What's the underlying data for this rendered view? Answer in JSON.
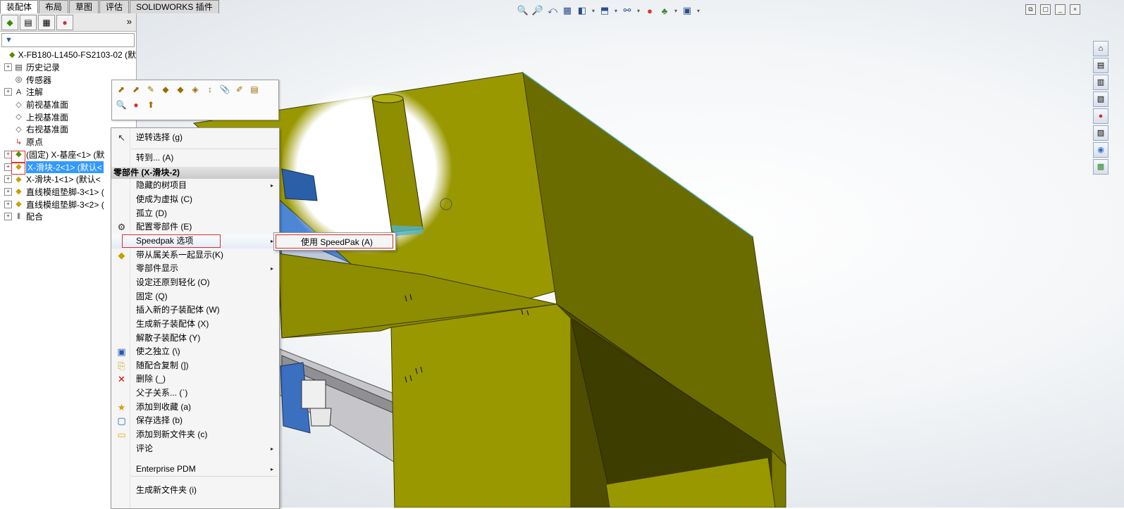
{
  "tabs": [
    "装配体",
    "布局",
    "草图",
    "评估",
    "SOLIDWORKS 插件"
  ],
  "active_tab": 0,
  "view_toolbar_icons": [
    "zoom-to-fit-icon",
    "zoom-to-area-icon",
    "previous-view-icon",
    "section-view-icon",
    "view-orientation-icon",
    "display-style-icon",
    "hide-show-items-icon",
    "edit-appearance-icon",
    "apply-scene-icon",
    "view-settings-icon"
  ],
  "window_controls": [
    "restore",
    "tile",
    "minimize-window",
    "close"
  ],
  "task_pane_icons": [
    "home-icon",
    "resources-icon",
    "design-library-icon",
    "file-explorer-icon",
    "view-palette-icon",
    "appearances-icon",
    "custom-properties-icon",
    "forum-icon"
  ],
  "feature_manager": {
    "more_label": "»",
    "filter_label": "▼",
    "tree": [
      {
        "label": "X-FB180-L1450-FS2103-02  (默",
        "icon": "assembly-icon",
        "expand": "",
        "indent": 0
      },
      {
        "label": "历史记录",
        "icon": "history-icon",
        "expand": "+",
        "indent": 1
      },
      {
        "label": "传感器",
        "icon": "sensor-icon",
        "expand": "",
        "indent": 1
      },
      {
        "label": "注解",
        "icon": "annotation-icon",
        "expand": "+",
        "indent": 1
      },
      {
        "label": "前视基准面",
        "icon": "plane-icon",
        "expand": "",
        "indent": 1
      },
      {
        "label": "上视基准面",
        "icon": "plane-icon",
        "expand": "",
        "indent": 1
      },
      {
        "label": "右视基准面",
        "icon": "plane-icon",
        "expand": "",
        "indent": 1
      },
      {
        "label": "原点",
        "icon": "origin-icon",
        "expand": "",
        "indent": 1
      },
      {
        "label": "(固定) X-基座<1> (默",
        "icon": "fixed-part-icon",
        "expand": "+",
        "indent": 1
      },
      {
        "label": "X-滑块-2<1> (默认<",
        "icon": "subassembly-icon",
        "expand": "+",
        "indent": 1,
        "selected": true
      },
      {
        "label": "X-滑块-1<1> (默认<",
        "icon": "subassembly-icon",
        "expand": "+",
        "indent": 1
      },
      {
        "label": "直线模组垫脚-3<1> (",
        "icon": "subassembly-icon",
        "expand": "+",
        "indent": 1
      },
      {
        "label": "直线模组垫脚-3<2> (",
        "icon": "subassembly-icon",
        "expand": "+",
        "indent": 1
      },
      {
        "label": "配合",
        "icon": "mates-icon",
        "expand": "+",
        "indent": 1
      }
    ]
  },
  "context_toolbar": {
    "row1": [
      "open-part-icon",
      "open-assembly-icon",
      "edit-part-icon",
      "edit-assembly-icon",
      "component-properties-icon",
      "hide-components-icon",
      "move-components-icon",
      "mate-icon",
      "edit-sketch-icon",
      "properties-icon"
    ],
    "row2": [
      "zoom-to-selection-icon",
      "appearance-icon",
      "make-virtual-icon"
    ]
  },
  "context_menu": {
    "header": "零部件 (X-滑块-2)",
    "items": [
      {
        "label": "逆转选择 (g)",
        "icon": "select-cursor-icon"
      },
      {
        "label": "转到... (A)",
        "icon": ""
      },
      {
        "label": "隐藏的树项目",
        "icon": "",
        "submenu": true
      },
      {
        "label": "使成为虚拟 (C)",
        "icon": ""
      },
      {
        "label": "孤立 (D)",
        "icon": ""
      },
      {
        "label": "配置零部件 (E)",
        "icon": "configure-component-icon"
      },
      {
        "label": "Speedpak 选项",
        "icon": "",
        "submenu": true,
        "highlighted": true
      },
      {
        "label": "带从属关系一起显示(K)",
        "icon": "show-with-dependents-icon"
      },
      {
        "label": "零部件显示",
        "icon": "",
        "submenu": true
      },
      {
        "label": "设定还原到轻化 (O)",
        "icon": ""
      },
      {
        "label": "固定 (Q)",
        "icon": ""
      },
      {
        "label": "插入新的子装配体 (W)",
        "icon": ""
      },
      {
        "label": "生成新子装配体 (X)",
        "icon": ""
      },
      {
        "label": "解散子装配体 (Y)",
        "icon": ""
      },
      {
        "label": "使之独立 (\\)",
        "icon": "make-independent-icon"
      },
      {
        "label": "随配合复制 (])",
        "icon": "copy-with-mates-icon"
      },
      {
        "label": "删除 (_)",
        "icon": "delete-icon"
      },
      {
        "label": "父子关系... (`)",
        "icon": ""
      },
      {
        "label": "添加到收藏 (a)",
        "icon": "favorites-icon"
      },
      {
        "label": "保存选择 (b)",
        "icon": "save-selection-icon"
      },
      {
        "label": "添加到新文件夹 (c)",
        "icon": "folder-icon"
      },
      {
        "label": "评论",
        "icon": "",
        "submenu": true
      },
      {
        "label": "Enterprise PDM",
        "icon": "",
        "submenu": true
      },
      {
        "label": "生成新文件夹 (i)",
        "icon": ""
      }
    ]
  },
  "submenu": {
    "label": "使用 SpeedPak (A)"
  },
  "colors": {
    "model_face_top": "#9a9800",
    "model_face_side": "#6b6c00",
    "model_face_dark": "#4e4d00",
    "selection_blue": "#3399ff",
    "annotation_red": "#d9302b"
  }
}
